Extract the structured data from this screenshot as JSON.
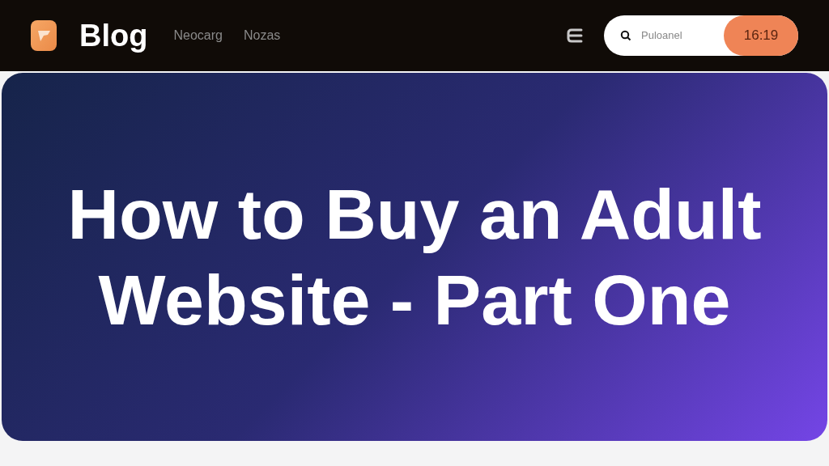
{
  "header": {
    "logo_text": "Blog",
    "nav": [
      {
        "label": "Neocarg"
      },
      {
        "label": "Nozas"
      }
    ],
    "search": {
      "placeholder": "Puloanel"
    },
    "badge": "16:19"
  },
  "hero": {
    "title": "How to Buy an Adult Website - Part One"
  }
}
